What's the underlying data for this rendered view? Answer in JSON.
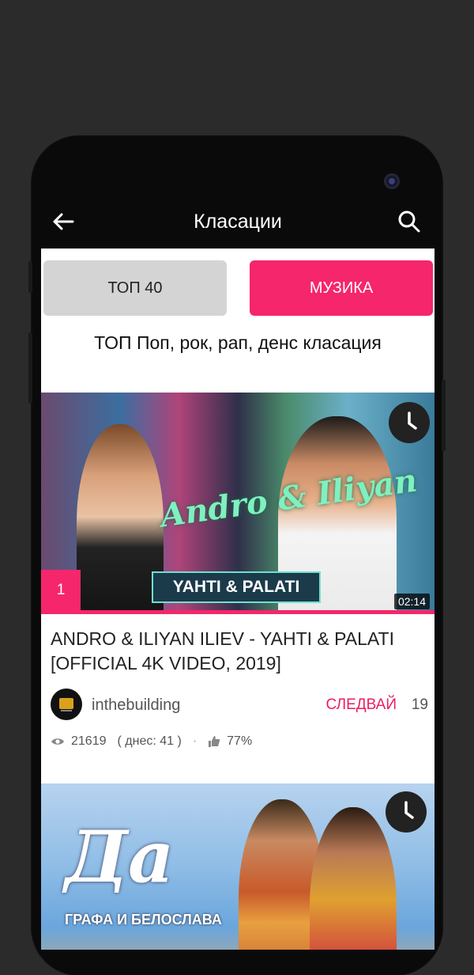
{
  "appbar": {
    "title": "Класации"
  },
  "tabs": [
    {
      "label": "ТОП 40",
      "active": false
    },
    {
      "label": "МУЗИКА",
      "active": true
    }
  ],
  "subtitle": "ТОП Поп, рок, рап, денс класация",
  "videos": [
    {
      "rank": "1",
      "duration": "02:14",
      "thumb_text": "YAHTI & PALATI",
      "thumb_logo": "Andro & Iliyan",
      "title": "ANDRO & ILIYAN ILIEV - YAHTI & PALATI [OFFICIAL 4K VIDEO, 2019]",
      "channel": "inthebuilding",
      "follow_label": "СЛЕДВАЙ",
      "follow_count": "19",
      "views": "21619",
      "today": "( днес: 41 )",
      "separator": "·",
      "likes": "77%"
    },
    {
      "thumb_logo": "Да",
      "thumb_caption": "ГРАФА И БЕЛОСЛАВА"
    }
  ],
  "colors": {
    "accent": "#f5266b",
    "follow": "#e91e63",
    "tab_inactive": "#d4d4d4"
  }
}
